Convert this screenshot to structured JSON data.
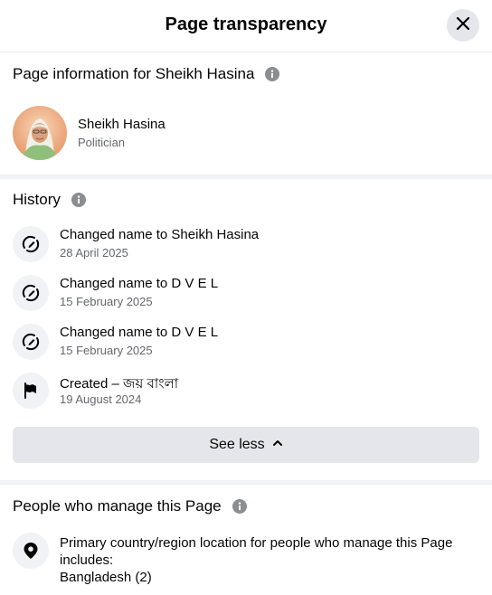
{
  "header": {
    "title": "Page transparency"
  },
  "page_info": {
    "title": "Page information for Sheikh Hasina",
    "profile_name": "Sheikh Hasina",
    "profile_category": "Politician"
  },
  "history": {
    "title": "History",
    "items": [
      {
        "icon": "rename-icon",
        "text": "Changed name to Sheikh Hasina",
        "date": "28 April 2025"
      },
      {
        "icon": "rename-icon",
        "text": "Changed name to D V E L",
        "date": "15 February 2025"
      },
      {
        "icon": "rename-icon",
        "text": "Changed name to D V E L",
        "date": "15 February 2025"
      },
      {
        "icon": "flag-icon",
        "text": "Created – জয় বাংলা",
        "date": "19 August 2024"
      }
    ],
    "see_less_label": "See less"
  },
  "managers": {
    "title": "People who manage this Page",
    "location_line1": "Primary country/region location for people who manage this Page includes:",
    "location_line2": "Bangladesh (2)"
  },
  "colors": {
    "background": "#ffffff",
    "divider": "#f0f2f5",
    "button_bg": "#e4e6eb",
    "secondary_text": "#65676b",
    "primary_text": "#050505"
  }
}
